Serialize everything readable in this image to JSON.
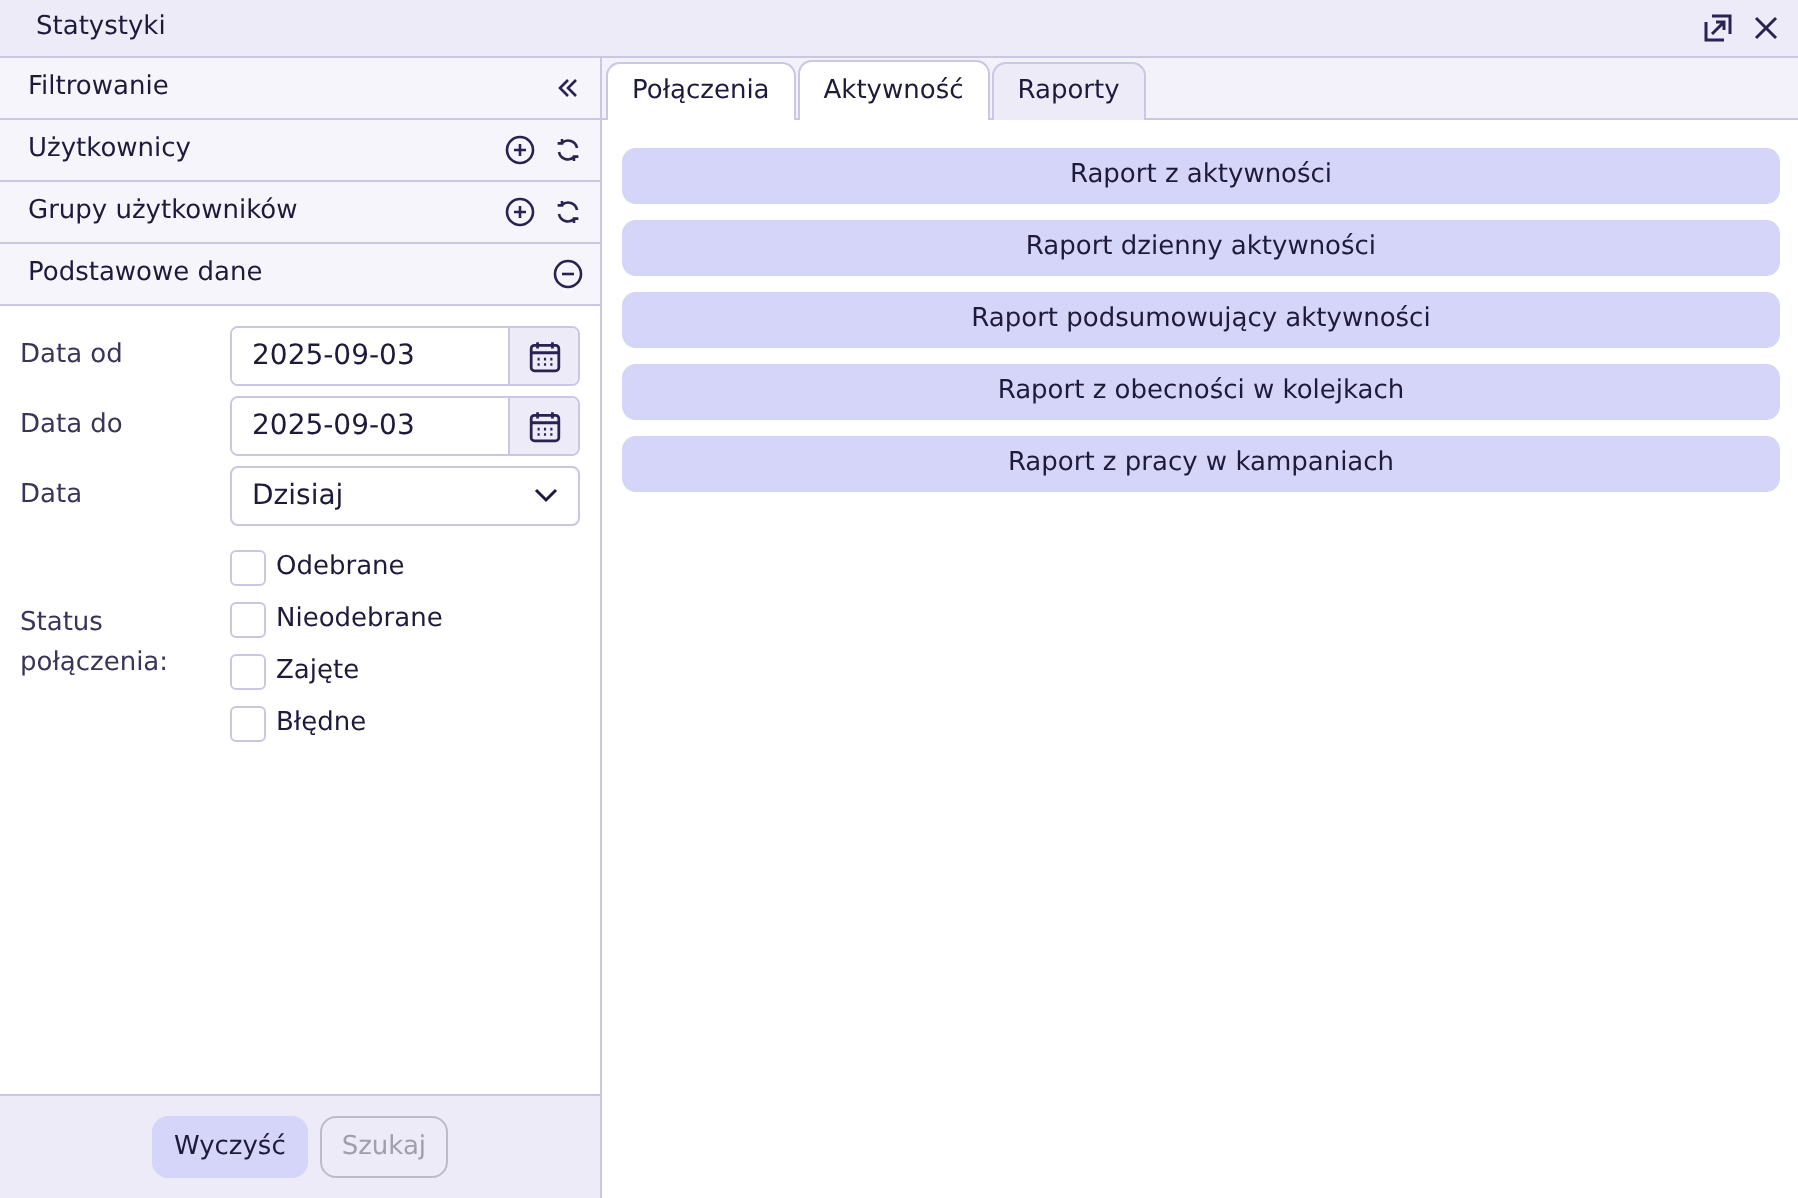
{
  "window": {
    "title": "Statystyki"
  },
  "sidebar": {
    "sections": [
      {
        "label": "Filtrowanie",
        "actions": [
          {
            "kind": "collapse"
          }
        ]
      },
      {
        "label": "Użytkownicy",
        "actions": [
          {
            "kind": "add"
          },
          {
            "kind": "refresh"
          }
        ]
      },
      {
        "label": "Grupy użytkowników",
        "actions": [
          {
            "kind": "add"
          },
          {
            "kind": "refresh"
          }
        ]
      },
      {
        "label": "Podstawowe dane",
        "actions": [
          {
            "kind": "remove"
          }
        ]
      }
    ],
    "fields": [
      {
        "kind": "date",
        "label": "Data od",
        "value": "2025-09-03"
      },
      {
        "kind": "date",
        "label": "Data do",
        "value": "2025-09-03"
      },
      {
        "kind": "select",
        "label": "Data",
        "value": "Dzisiaj"
      }
    ],
    "status": {
      "label": "Status połączenia:",
      "options": [
        {
          "label": "Odebrane",
          "checked": false
        },
        {
          "label": "Nieodebrane",
          "checked": false
        },
        {
          "label": "Zajęte",
          "checked": false
        },
        {
          "label": "Błędne",
          "checked": false
        }
      ]
    },
    "buttons": [
      {
        "label": "Wyczyść",
        "disabled": false
      },
      {
        "label": "Szukaj",
        "disabled": true
      }
    ]
  },
  "tabs": [
    {
      "label": "Połączenia",
      "selected": false,
      "hovered": false
    },
    {
      "label": "Aktywność",
      "selected": true,
      "hovered": false
    },
    {
      "label": "Raporty",
      "selected": false,
      "hovered": true
    }
  ],
  "reports": [
    "Raport z aktywności",
    "Raport dzienny aktywności",
    "Raport podsumowujący aktywności",
    "Raport z obecności w kolejkach",
    "Raport z pracy w kampaniach"
  ]
}
